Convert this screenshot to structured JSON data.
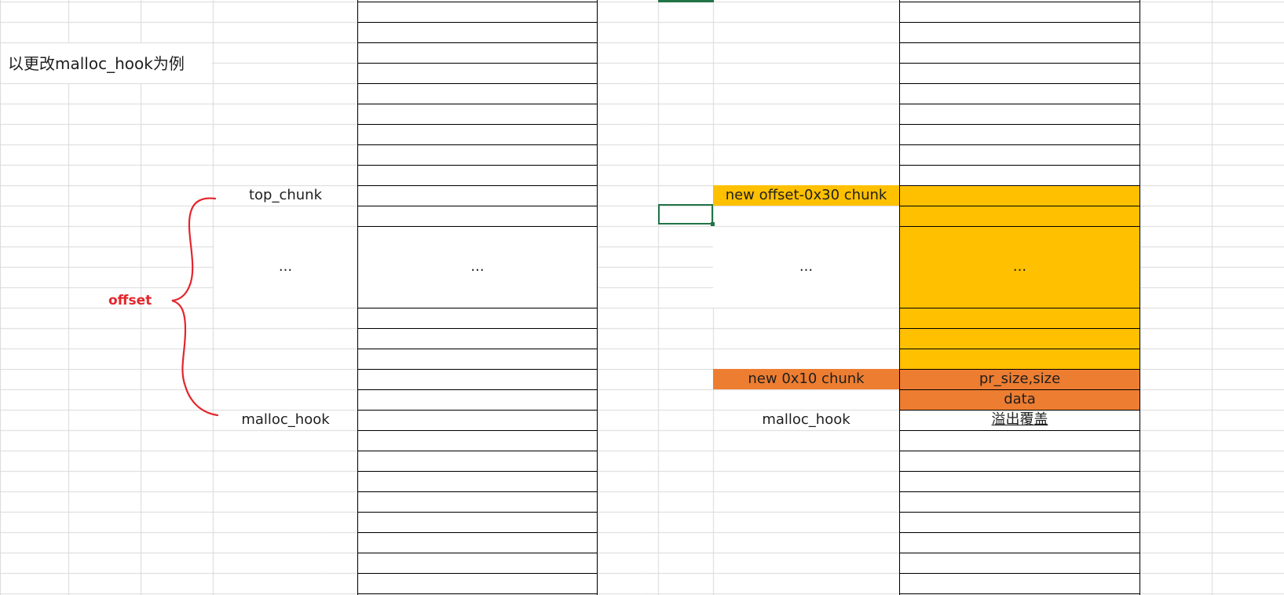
{
  "note": "以更改malloc_hook为例",
  "annotation": {
    "offset": "offset",
    "brace_color": "#e3262c"
  },
  "colors": {
    "gridline": "#d9d9d9",
    "border": "#000000",
    "yellow": "#ffc000",
    "orange": "#ed7d31",
    "selection": "#217346"
  },
  "left_memory": {
    "top_label": "top_chunk",
    "ellipsis_label": "...",
    "ellipsis_cell": "...",
    "bottom_label": "malloc_hook"
  },
  "right_memory": {
    "new_offset_chunk": "new offset-0x30 chunk",
    "ellipsis_label": "...",
    "ellipsis_cell": "...",
    "new_small_chunk": "new 0x10 chunk",
    "header_cell": "pr_size,size",
    "data_cell": "data",
    "malloc_hook_label": "malloc_hook",
    "overflow_cell": "溢出覆盖"
  }
}
